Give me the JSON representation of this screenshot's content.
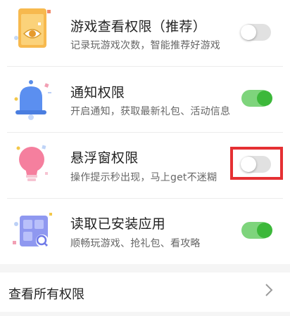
{
  "permissions": [
    {
      "title": "游戏查看权限（推荐）",
      "subtitle": "记录玩游戏次数，智能推荐好游戏",
      "enabled": false,
      "icon": "game-view-icon"
    },
    {
      "title": "通知权限",
      "subtitle": "开启通知，获取最新礼包、活动信息",
      "enabled": true,
      "icon": "bell-icon"
    },
    {
      "title": "悬浮窗权限",
      "subtitle": "操作提示秒出现，马上get不迷糊",
      "enabled": false,
      "icon": "lightbulb-icon"
    },
    {
      "title": "读取已安装应用",
      "subtitle": "顺畅玩游戏、抢礼包、看攻略",
      "enabled": true,
      "icon": "installed-apps-icon"
    }
  ],
  "view_all": {
    "label": "查看所有权限",
    "icon": "chevron-right-icon"
  },
  "colors": {
    "toggle_on": "#3cb83a",
    "toggle_track_on": "#7ed47c",
    "toggle_off": "#e1e1e1",
    "highlight": "#e53033"
  }
}
